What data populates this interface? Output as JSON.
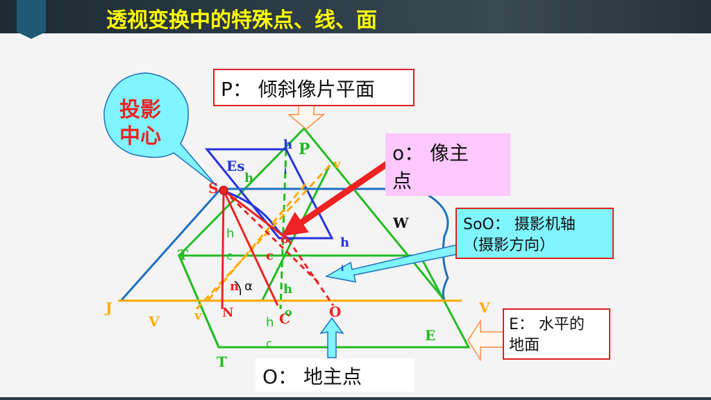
{
  "title": "透视变换中的特殊点、线、面",
  "callouts": {
    "projection_center": [
      "投影",
      "中心"
    ],
    "plane_p": "P： 倾斜像片平面",
    "principal_point": [
      "o： 像主",
      "点"
    ],
    "axis": [
      "SoO： 摄影机轴",
      "（摄影方向）"
    ],
    "ground_plane": [
      "E： 水平的",
      "地面"
    ],
    "ground_principal_point": "O： 地主点"
  },
  "labels": {
    "P": "P",
    "Es": "Es",
    "S": "S",
    "W": "W",
    "T": "T",
    "J": "J",
    "V": "V",
    "v": "v",
    "N": "N",
    "O": "O",
    "C": "C",
    "E": "E",
    "o": "o",
    "c": "c",
    "n": "n",
    "h": "h",
    "i": "i",
    "alpha": "α"
  },
  "colors": {
    "header_text": "#ffff00",
    "green": "#22bb22",
    "blue": "#2233dd",
    "red": "#ee2222",
    "orange": "#ffaa00",
    "steel": "#1c6fc0",
    "callout_cyan": "#80f4ff",
    "callout_pink": "#ffc8ff",
    "callout_border_red": "#e02020"
  }
}
